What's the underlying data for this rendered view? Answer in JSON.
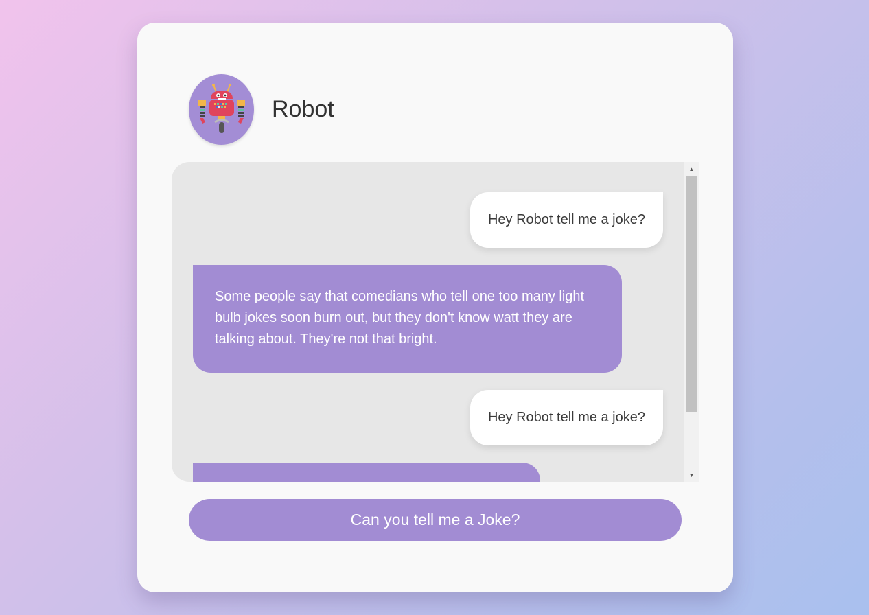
{
  "bot": {
    "name": "Robot",
    "avatar_icon": "robot-icon"
  },
  "messages": [
    {
      "from": "user",
      "text": "Hey Robot tell me a joke?"
    },
    {
      "from": "bot",
      "text": "Some people say that comedians who tell one too many light bulb jokes soon burn out, but they don't know watt they are talking about. They're not that bright."
    },
    {
      "from": "user",
      "text": "Hey Robot tell me a joke?"
    },
    {
      "from": "bot",
      "text": ""
    }
  ],
  "cta": {
    "label": "Can you tell me a Joke?"
  },
  "scroll": {
    "up_icon": "triangle-up-icon",
    "down_icon": "triangle-down-icon"
  },
  "colors": {
    "accent": "#a28cd3",
    "card": "#f9f9f9",
    "chat_bg": "#e7e7e7",
    "user_bubble": "#ffffff"
  }
}
